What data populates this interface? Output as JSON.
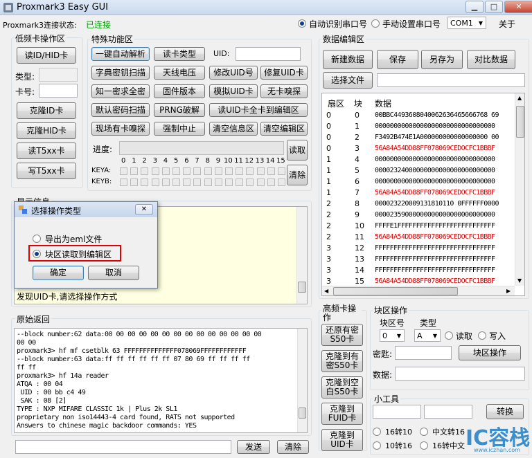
{
  "window": {
    "title": "Proxmark3 Easy GUI"
  },
  "status": {
    "label": "Proxmark3连接状态:",
    "value": "已连接",
    "value_color": "#009900"
  },
  "port": {
    "auto_label": "自动识别串口号",
    "manual_label": "手动设置串口号",
    "selected": "COM1",
    "about": "关于"
  },
  "lf": {
    "title": "低频卡操作区",
    "read_btn": "读ID/HID卡",
    "type_label": "类型:",
    "card_label": "卡号:",
    "buttons": [
      "克隆ID卡",
      "克隆HID卡",
      "读T5xx卡",
      "写T5xx卡"
    ]
  },
  "special": {
    "title": "特殊功能区",
    "uid_label": "UID:",
    "buttons": [
      [
        "一键自动解析",
        "读卡类型"
      ],
      [
        "字典密钥扫描",
        "天线电压",
        "修改UID号",
        "修复UID卡"
      ],
      [
        "知一密求全密",
        "固件版本",
        "模拟UID卡",
        "无卡嗅探"
      ],
      [
        "默认密码扫描",
        "PRNG破解",
        "读UID卡全卡到编辑区"
      ],
      [
        "现场有卡嗅探",
        "强制中止",
        "清空信息区",
        "清空编辑区"
      ]
    ],
    "progress_label": "进度:",
    "read_btn": "读取",
    "clear_btn": "清除",
    "sector_numbers": [
      "0",
      "1",
      "2",
      "3",
      "4",
      "5",
      "6",
      "7",
      "8",
      "9",
      "10",
      "11",
      "12",
      "13",
      "14",
      "15"
    ],
    "keya_label": "KEYA:",
    "keyb_label": "KEYB:"
  },
  "info": {
    "title": "显示信息",
    "message": "发现UID卡,请选择操作方式"
  },
  "dialog": {
    "title": "选择操作类型",
    "close": "✕",
    "option1": "导出为eml文件",
    "option2": "块区读取到编辑区",
    "ok": "确定",
    "cancel": "取消"
  },
  "raw": {
    "title": "原始返回",
    "lines": [
      "--block number:62 data:00 00 00 00 00 00 00 00 00 00 00 00 00 00",
      "00 00",
      "proxmark3> hf mf csetblk 63 FFFFFFFFFFFFFF078069FFFFFFFFFFFF",
      "--block number:63 data:ff ff ff ff ff ff 07 80 69 ff ff ff ff",
      "ff ff",
      "proxmark3> hf 14a reader",
      "ATQA : 00 04",
      " UID : 00 bb c4 49",
      " SAK : 08 [2]",
      "TYPE : NXP MIFARE CLASSIC 1k | Plus 2k SL1",
      "proprietary non iso14443-4 card found, RATS not supported",
      "Answers to chinese magic backdoor commands: YES"
    ],
    "send_btn": "发送",
    "clear_btn": "清除"
  },
  "editor": {
    "title": "数据编辑区",
    "buttons": [
      "新建数据",
      "保存",
      "另存为",
      "对比数据"
    ],
    "select_file": "选择文件",
    "columns": [
      "扇区",
      "块",
      "数据"
    ],
    "rows": [
      [
        "0",
        "0",
        "00BBC4493608040062636465666768 69",
        false
      ],
      [
        "0",
        "1",
        "00000000000000000000000000000000",
        false
      ],
      [
        "0",
        "2",
        "F3492B474E1A000000000000000000 00",
        false
      ],
      [
        "0",
        "3",
        "56A84A54DD88FF078069CEDOCFC1BBBF",
        true
      ],
      [
        "1",
        "4",
        "00000000000000000000000000000000",
        false
      ],
      [
        "1",
        "5",
        "00002324000000000000000000000000",
        false
      ],
      [
        "1",
        "6",
        "00000000000000000000000000000000",
        false
      ],
      [
        "1",
        "7",
        "56A84A54DD88FF078069CEDOCFC1BBBF",
        true
      ],
      [
        "2",
        "8",
        "000023220009131810110 0FFFFFF0000",
        false
      ],
      [
        "2",
        "9",
        "00002359000000000000000000000000",
        false
      ],
      [
        "2",
        "10",
        "FFFFE1FFFFFFFFFFFFFFFFFFFFFFFFFF",
        false
      ],
      [
        "2",
        "11",
        "56A84A54DD88FF078069CEDOCFC1BBBF",
        true
      ],
      [
        "3",
        "12",
        "FFFFFFFFFFFFFFFFFFFFFFFFFFFFFFFF",
        false
      ],
      [
        "3",
        "13",
        "FFFFFFFFFFFFFFFFFFFFFFFFFFFFFFFF",
        false
      ],
      [
        "3",
        "14",
        "FFFFFFFFFFFFFFFFFFFFFFFFFFFFFFFF",
        false
      ],
      [
        "3",
        "15",
        "56A84A54DD88FF078069CEDOCFC1BBBF",
        true
      ]
    ]
  },
  "hf": {
    "title": "高频卡操作",
    "buttons": [
      "还原有密S50卡",
      "克隆到有密S50卡",
      "克隆到空白S50卡",
      "克隆到FUID卡",
      "克隆到UID卡"
    ]
  },
  "block": {
    "title": "块区操作",
    "num_label": "块区号",
    "type_label": "类型",
    "num_value": "0",
    "type_value": "A",
    "read_label": "读取",
    "write_label": "写入",
    "key_label": "密匙:",
    "op_btn": "块区操作",
    "data_label": "数据:"
  },
  "tools": {
    "title": "小工具",
    "convert_btn": "转换",
    "r1": "16转10",
    "r2": "中文转16",
    "r3": "10转16",
    "r4": "16转中文"
  },
  "watermark": {
    "text": "IC容栈",
    "url": "www.iczhan.com"
  }
}
